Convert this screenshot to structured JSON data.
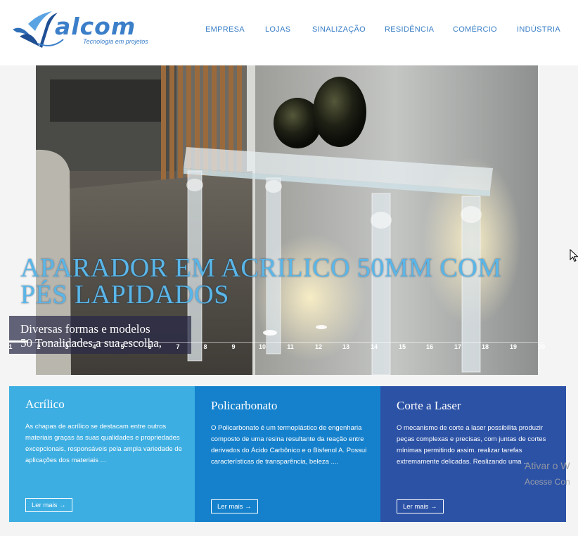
{
  "brand": {
    "name": "alcom",
    "tagline": "Tecnologia em projetos",
    "color": "#3b7fc9"
  },
  "nav": {
    "items": [
      {
        "label": "EMPRESA"
      },
      {
        "label": "LOJAS"
      },
      {
        "label": "SINALIZAÇÃO"
      },
      {
        "label": "RESIDÊNCIA"
      },
      {
        "label": "COMÉRCIO"
      },
      {
        "label": "INDÚSTRIA"
      }
    ]
  },
  "hero": {
    "title": "APARADOR EM ACRILICO 50MM COM PÉS LAPIDADOS",
    "subtitle_line1": "Diversas formas e modelos",
    "subtitle_line2": "50 Tonalidades a sua escolha,",
    "pages": [
      "1",
      "2",
      "3",
      "4",
      "5",
      "6",
      "7",
      "8",
      "9",
      "10",
      "11",
      "12",
      "13",
      "14",
      "15",
      "16",
      "17",
      "18",
      "19",
      "20"
    ],
    "active_page": "1"
  },
  "cards": [
    {
      "title": "Acrílico",
      "text": "As chapas de acrílico se destacam entre outros materiais graças às suas qualidades e propriedades excepcionais, responsáveis pela ampla variedade de aplicações dos materiais ...",
      "button": "Ler mais →",
      "color": "#3daee2"
    },
    {
      "title": "Policarbonato",
      "text": "O Policarbonato é um termoplástico de engenharia composto de uma resina resultante da reação entre derivados do Ácido Carbônico e o Bisfenol A. Possui características de transparência, beleza ....",
      "button": "Ler mais →",
      "color": "#1581cc"
    },
    {
      "title": "Corte a Laser",
      "text": "O mecanismo de corte a laser possibilita produzir peças complexas e precisas, com juntas de cortes mínimas permitindo assim. realizar tarefas extremamente delicadas. Realizando uma ...",
      "button": "Ler mais →",
      "color": "#2c52a6"
    }
  ],
  "watermark": {
    "line1": "Ativar o W",
    "line2": "Acesse Con"
  }
}
